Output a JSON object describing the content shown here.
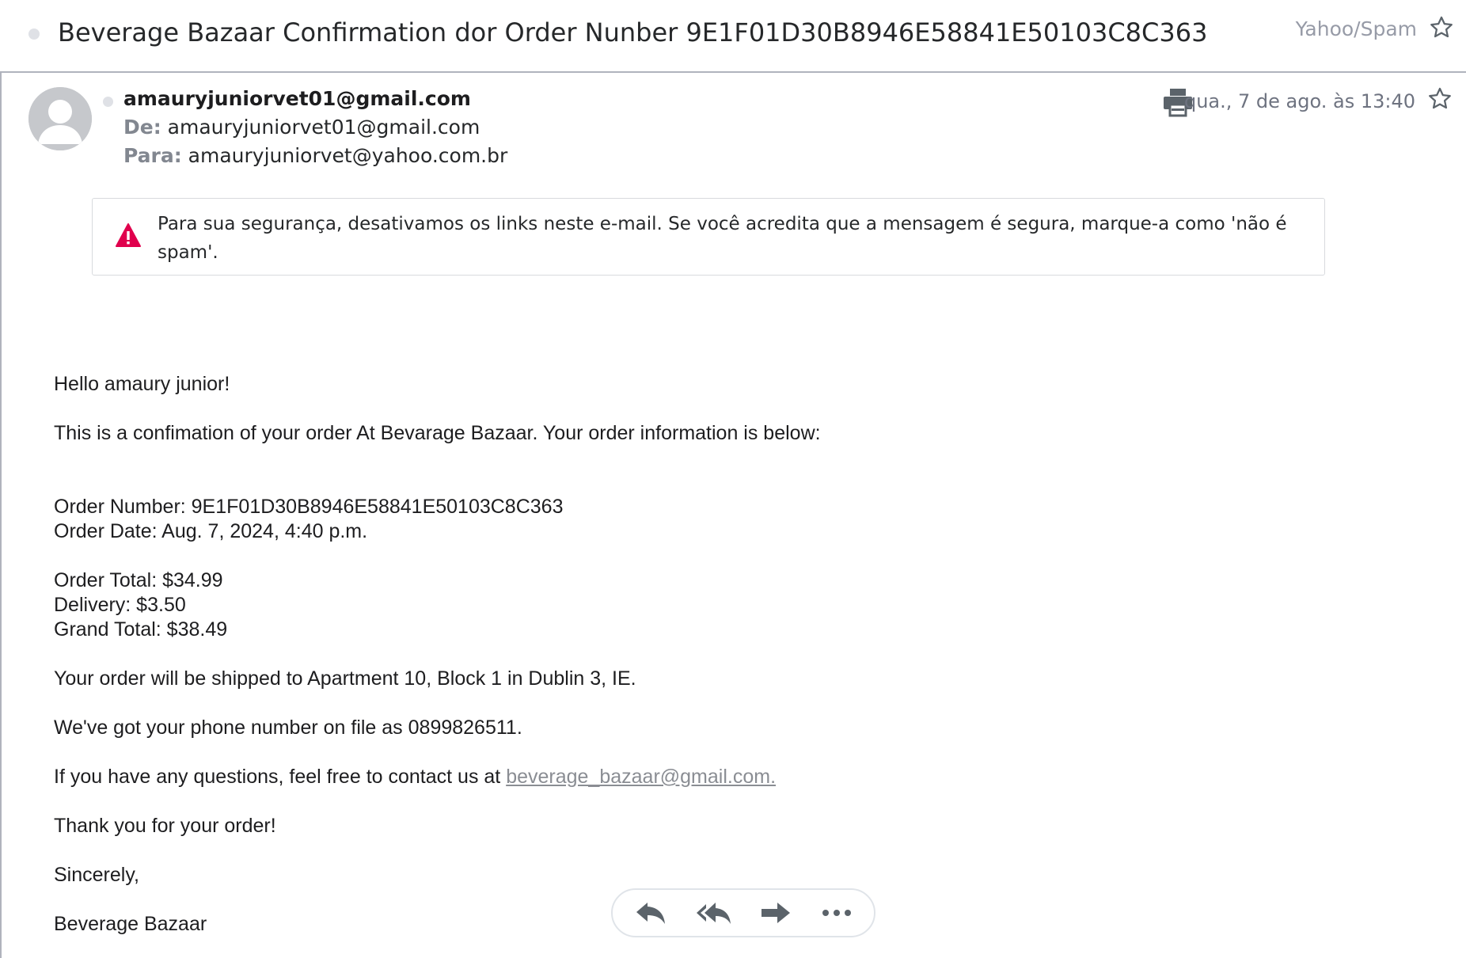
{
  "subject_bar": {
    "subject": "Beverage Bazaar Confirmation dor Order Nunber 9E1F01D30B8946E58841E50103C8C363",
    "folder": "Yahoo/Spam"
  },
  "header": {
    "sender_display": "amauryjuniorvet01@gmail.com",
    "from_label": "De:",
    "from_value": "amauryjuniorvet01@gmail.com",
    "to_label": "Para:",
    "to_value": "amauryjuniorvet@yahoo.com.br",
    "date": "qua., 7 de ago. às 13:40"
  },
  "warning": {
    "text": "Para sua segurança, desativamos os links neste e-mail. Se você acredita que a mensagem é segura, marque-a como 'não é spam'."
  },
  "body": {
    "greeting": "Hello amaury junior!",
    "intro": "This is a confimation of your order At Bevarage Bazaar. Your order information is below:",
    "order_number": "Order Number: 9E1F01D30B8946E58841E50103C8C363",
    "order_date": "Order Date: Aug. 7, 2024, 4:40 p.m.",
    "order_total": "Order Total: $34.99",
    "delivery": "Delivery: $3.50",
    "grand_total": "Grand Total: $38.49",
    "shipping": "Your order will be shipped to Apartment 10, Block 1 in Dublin 3, IE.",
    "phone": "We've got your phone number on file as 0899826511.",
    "questions_prefix": "If you have any questions, feel free to contact us at ",
    "questions_link": "beverage_bazaar@gmail.com.",
    "thanks": "Thank you for your order!",
    "closing": "Sincerely,",
    "signature": "Beverage Bazaar"
  },
  "actions": {
    "icons": [
      "reply-icon",
      "reply-all-icon",
      "forward-icon",
      "more-icon"
    ]
  },
  "colors": {
    "warning_red": "#e0004d",
    "icon_gray": "#5b636a",
    "link_gray": "#8a8d93"
  }
}
